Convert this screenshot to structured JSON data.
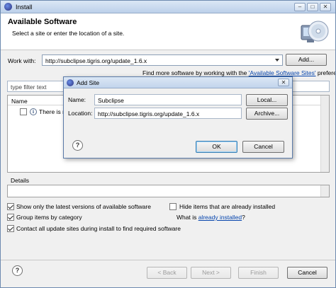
{
  "window": {
    "title": "Install",
    "minimize_label": "–",
    "maximize_label": "□",
    "close_label": "✕"
  },
  "header": {
    "title": "Available Software",
    "description": "Select a site or enter the location of a site."
  },
  "work_with": {
    "label": "Work with:",
    "value": "http://subclipse.tigris.org/update_1.6.x",
    "add_button": "Add..."
  },
  "find_more": {
    "prefix": "Find more software by working with the ",
    "link": "'Available Software Sites'",
    "suffix": " preferences."
  },
  "filter": {
    "placeholder": "type filter text"
  },
  "list": {
    "column_name": "Name",
    "rows": [
      {
        "text": "There is no"
      }
    ]
  },
  "details": {
    "label": "Details"
  },
  "options": {
    "show_latest": {
      "label": "Show only the latest versions of available software",
      "checked": true
    },
    "hide_installed": {
      "label": "Hide items that are already installed",
      "checked": false
    },
    "group_by_category": {
      "label": "Group items by category",
      "checked": true
    },
    "what_is_prefix": "What is ",
    "what_is_link": "already installed",
    "what_is_suffix": "?",
    "contact_sites": {
      "label": "Contact all update sites during install to find required software",
      "checked": true
    }
  },
  "footer": {
    "back": "< Back",
    "next": "Next >",
    "finish": "Finish",
    "cancel": "Cancel"
  },
  "add_site_dialog": {
    "title": "Add Site",
    "close_label": "✕",
    "name_label": "Name:",
    "name_value": "Subclipse",
    "local_button": "Local...",
    "location_label": "Location:",
    "location_value": "http://subclipse.tigris.org/update_1.6.x",
    "archive_button": "Archive...",
    "ok_button": "OK",
    "cancel_button": "Cancel"
  },
  "icons": {
    "app": "eclipse-icon",
    "banner": "install-cd-icon",
    "info": "info-icon",
    "help": "help-icon"
  },
  "colors": {
    "link": "#0645ad",
    "title_bar": "#bcd0ea",
    "dialog_border": "#5a7aa8"
  }
}
